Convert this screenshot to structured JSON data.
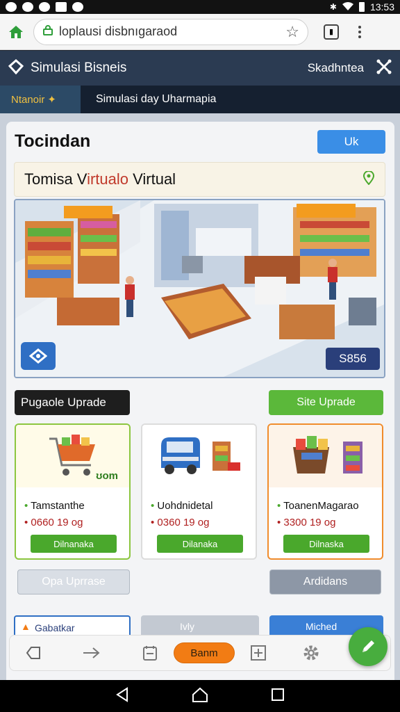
{
  "status": {
    "time": "13:53"
  },
  "browser": {
    "url": "loplausi disbnıgaraod"
  },
  "app": {
    "title": "Simulasi Bisneis",
    "right_label": "Skadhntea"
  },
  "subheader": {
    "tag": "Ntanoir",
    "text": "Simulasi day Uharmapia"
  },
  "panel": {
    "title": "Tocindan",
    "ok_label": "Uk",
    "sim_card": {
      "prefix": "Tomisa V",
      "accent": "irtualo",
      "suffix": " Virtual"
    },
    "money": "S856"
  },
  "upgrades": {
    "tab_label": "Pugaole Uprade",
    "site_button": "Site Uprade",
    "items": [
      {
        "badge": "ʊom",
        "name": "Tamstanthe",
        "price": "0660 19 og",
        "button": "Dilnanaka"
      },
      {
        "badge": "",
        "name": "Uohdnidetal",
        "price": "0360 19 og",
        "button": "Dilanaka"
      },
      {
        "badge": "",
        "name": "ToanenMagarao",
        "price": "3300 19 og",
        "button": "Dilnaska"
      }
    ],
    "op_button": "Opa Uprrase",
    "right_button": "Ardidans"
  },
  "lower_tabs": [
    "Gabatkar",
    "Ivly",
    "Miched"
  ],
  "bottom_nav": {
    "active_label": "Banm"
  },
  "colors": {
    "accent_green": "#4aa82c",
    "accent_blue": "#3a8ee6",
    "accent_orange": "#f27c14",
    "header_navy": "#2b3b52"
  }
}
